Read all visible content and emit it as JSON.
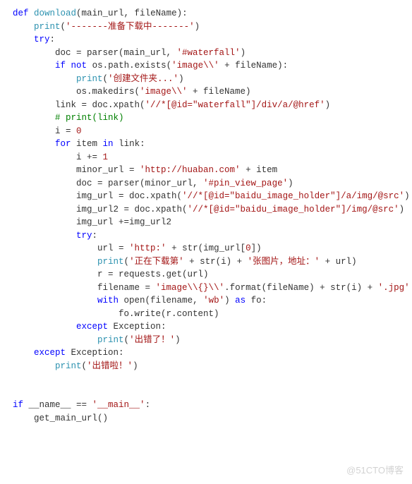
{
  "watermark": "@51CTO博客",
  "code": {
    "l1": {
      "t1": "def",
      "t2": "download",
      "t3": "(main_url, fileName):"
    },
    "l2": {
      "t1": "print",
      "t2": "(",
      "t3": "'-------准备下载中-------'",
      "t4": ")"
    },
    "l3": {
      "t1": "try",
      "t2": ":"
    },
    "l4": {
      "t1": "doc = parser(main_url, ",
      "t2": "'#waterfall'",
      "t3": ")"
    },
    "l5": {
      "t1": "if",
      "t2": "not",
      "t3": " os.path.exists(",
      "t4": "'image\\\\'",
      "t5": " + fileName):"
    },
    "l6": {
      "t1": "print",
      "t2": "(",
      "t3": "'创建文件夹...'",
      "t4": ")"
    },
    "l7": {
      "t1": "os.makedirs(",
      "t2": "'image\\\\'",
      "t3": " + fileName)"
    },
    "l8": {
      "t1": "link = doc.xpath(",
      "t2": "'//*[@id=\"waterfall\"]/div/a/@href'",
      "t3": ")"
    },
    "l9": {
      "t1": "# print(link)"
    },
    "l10": {
      "t1": "i = ",
      "t2": "0"
    },
    "l11": {
      "t1": "for",
      "t2": " item ",
      "t3": "in",
      "t4": " link:"
    },
    "l12": {
      "t1": "i += ",
      "t2": "1"
    },
    "l13": {
      "t1": "minor_url = ",
      "t2": "'http://huaban.com'",
      "t3": " + item"
    },
    "l14": {
      "t1": "doc = parser(minor_url, ",
      "t2": "'#pin_view_page'",
      "t3": ")"
    },
    "l15": {
      "t1": "img_url = doc.xpath(",
      "t2": "'//*[@id=\"baidu_image_holder\"]/a/img/@src'",
      "t3": ")"
    },
    "l16": {
      "t1": "img_url2 = doc.xpath(",
      "t2": "'//*[@id=\"baidu_image_holder\"]/img/@src'",
      "t3": ")"
    },
    "l17": {
      "t1": "img_url +=img_url2"
    },
    "l18": {
      "t1": "try",
      "t2": ":"
    },
    "l19": {
      "t1": "url = ",
      "t2": "'http:'",
      "t3": " + str(img_url[",
      "t4": "0",
      "t5": "])"
    },
    "l20": {
      "t1": "print",
      "t2": "(",
      "t3": "'正在下载第'",
      "t4": " + str(i) + ",
      "t5": "'张图片，地址：'",
      "t6": " + url)"
    },
    "l21": {
      "t1": "r = requests.get(url)"
    },
    "l22": {
      "t1": "filename = ",
      "t2": "'image\\\\{}\\\\'",
      "t3": ".format(fileName) + str(i) + ",
      "t4": "'.jpg'"
    },
    "l23": {
      "t1": "with",
      "t2": " open(filename, ",
      "t3": "'wb'",
      "t4": ") ",
      "t5": "as",
      "t6": " fo:"
    },
    "l24": {
      "t1": "fo.write(r.content)"
    },
    "l25": {
      "t1": "except",
      "t2": " Exception:"
    },
    "l26": {
      "t1": "print",
      "t2": "(",
      "t3": "'出错了！'",
      "t4": ")"
    },
    "l27": {
      "t1": "except",
      "t2": " Exception:"
    },
    "l28": {
      "t1": "print",
      "t2": "(",
      "t3": "'出错啦！'",
      "t4": ")"
    },
    "l31": {
      "t1": "if",
      "t2": " __name__ == ",
      "t3": "'__main__'",
      "t4": ":"
    },
    "l32": {
      "t1": "get_main_url()"
    }
  }
}
